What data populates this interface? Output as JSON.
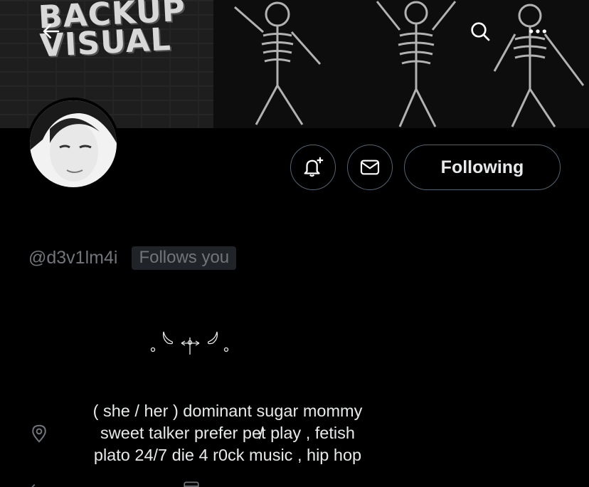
{
  "banner": {
    "graffiti_text": "BACKUP\nVISUAL"
  },
  "nav": {
    "back_icon": "arrow-left-icon",
    "search_icon": "search-icon",
    "more_icon": "more-horizontal-icon"
  },
  "actions": {
    "notify_icon": "bell-plus-icon",
    "message_icon": "envelope-icon",
    "following_label": "Following"
  },
  "profile": {
    "handle": "@d3v1lm4i",
    "follows_you": "Follows you",
    "bio_lines": [
      "( she / her ) dominant sugar mommy",
      "sweet talker prefer pe̸t play , fetish",
      "plato 24/7 die 4 r0ck music , hip hop"
    ],
    "location_icon": "location-pin-icon"
  },
  "colors": {
    "background": "#000000",
    "text_primary": "#e7e9ea",
    "text_secondary": "#71767b",
    "border": "#536471",
    "badge_bg": "#202327"
  }
}
